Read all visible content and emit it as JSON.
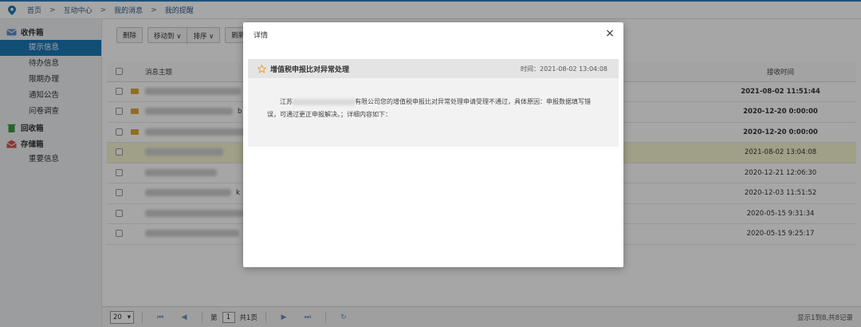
{
  "breadcrumb": {
    "items": [
      "首页",
      "互动中心",
      "我的消息",
      "我的提醒"
    ],
    "separator": ">"
  },
  "sidebar": {
    "inbox": {
      "label": "收件箱",
      "items": [
        "提示信息",
        "待办信息",
        "限期办理",
        "通知公告",
        "问卷调查"
      ],
      "active_index": 0
    },
    "recycle": {
      "label": "回收箱"
    },
    "storage": {
      "label": "存储箱",
      "items": [
        "重要信息"
      ]
    }
  },
  "toolbar": {
    "delete": "删除",
    "move_to": "移动到 ∨",
    "sort": "排序 ∨",
    "refresh": "刷新"
  },
  "table": {
    "columns": {
      "subject": "消息主题",
      "received_time": "接收时间"
    },
    "rows": [
      {
        "time": "2021-08-02 11:51:44",
        "unread": true,
        "tail": ""
      },
      {
        "time": "2020-12-20 0:00:00",
        "unread": true,
        "tail": "b"
      },
      {
        "time": "2020-12-20 0:00:00",
        "unread": true,
        "tail": ""
      },
      {
        "time": "2021-08-02 13:04:08",
        "unread": false,
        "tail": ""
      },
      {
        "time": "2020-12-21 12:06:30",
        "unread": false,
        "tail": ""
      },
      {
        "time": "2020-12-03 11:51:52",
        "unread": false,
        "tail": "k"
      },
      {
        "time": "2020-05-15 9:31:34",
        "unread": false,
        "tail": ""
      },
      {
        "time": "2020-05-15 9:25:17",
        "unread": false,
        "tail": ""
      }
    ]
  },
  "pager": {
    "page_size": "20",
    "page_prefix": "第",
    "page_value": "1",
    "page_suffix": "共1页",
    "info": "显示1到8,共8记录"
  },
  "modal": {
    "title": "详情",
    "close": "×",
    "message_title": "增值税申报比对异常处理",
    "time": "时间：2021-08-02 13:04:08",
    "content_prefix": "江苏",
    "content_body": "有限公司您的增值税申报比对异常处理申请受理不通过，具体原因：申报数据填写错误，可通过更正申报解决。；详细内容如下："
  },
  "colors": {
    "accent": "#1b79b6",
    "highlight_row": "#f6f4cf",
    "envelope": "#e2a63b"
  }
}
